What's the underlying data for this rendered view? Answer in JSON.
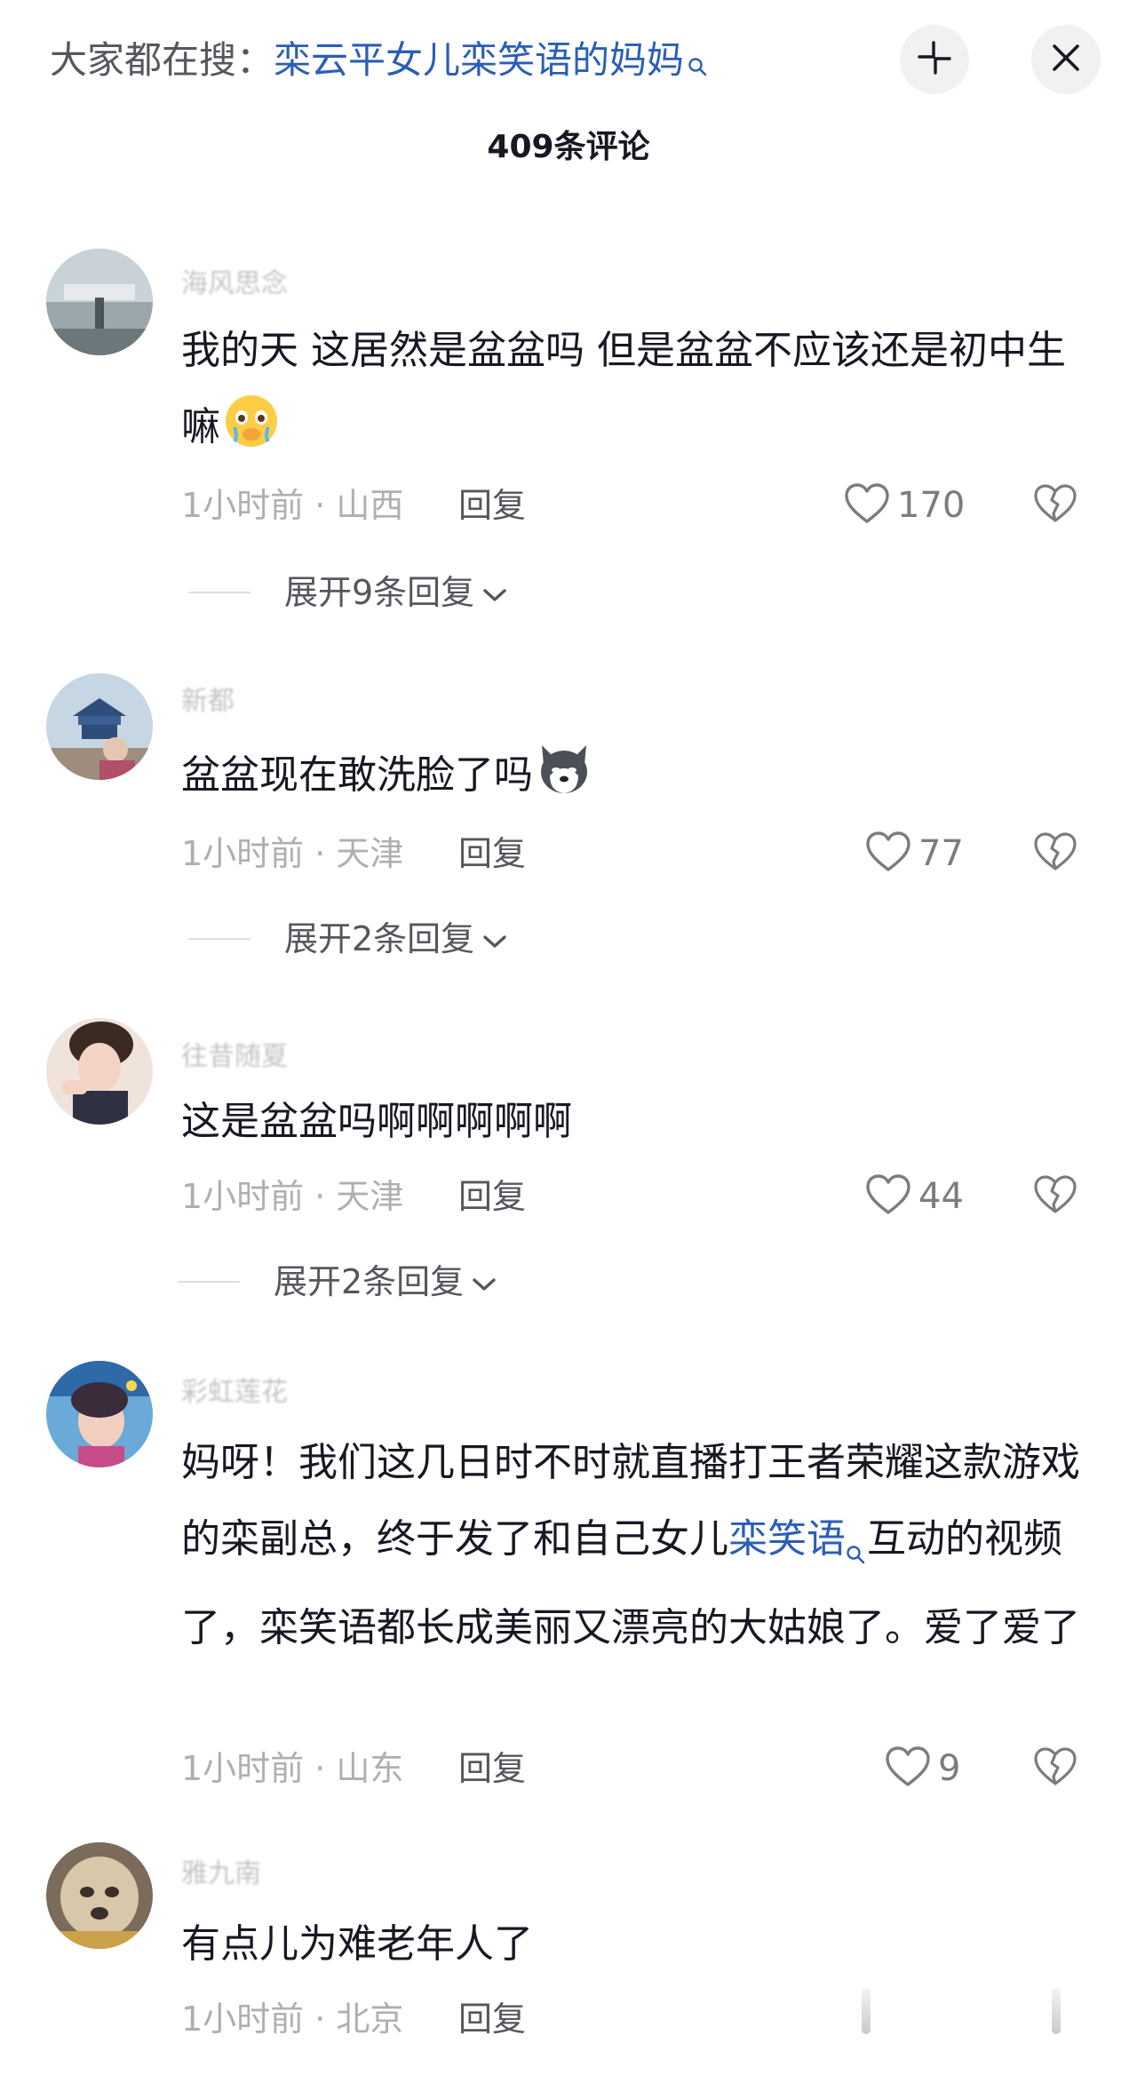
{
  "header": {
    "search_prefix": "大家都在搜：",
    "search_term": "栾云平女儿栾笑语的妈妈",
    "comment_count": "409条评论"
  },
  "comments": [
    {
      "username": "海风思念",
      "text_before_emoji": "我的天 这居然是盆盆吗 但是盆盆不应该还是初中生嘛",
      "emoji": "teary-face-emoji",
      "time_location": "1小时前 · 山西",
      "reply_label": "回复",
      "like_count": "170",
      "expand_label": "展开9条回复"
    },
    {
      "username": "新都",
      "text_before_emoji": "盆盆现在敢洗脸了吗",
      "emoji": "husky-face-emoji",
      "time_location": "1小时前 · 天津",
      "reply_label": "回复",
      "like_count": "77",
      "expand_label": "展开2条回复"
    },
    {
      "username": "往昔随夏",
      "text": "这是盆盆吗啊啊啊啊啊",
      "time_location": "1小时前 · 天津",
      "reply_label": "回复",
      "like_count": "44",
      "expand_label": "展开2条回复"
    },
    {
      "username": "彩虹莲花",
      "text_part1": "妈呀！我们这几日时不时就直播打王者荣耀这款游戏的栾副总，终于发了和自己女儿",
      "text_keyword": "栾笑语",
      "text_part2": "互动的视频了，栾笑语都长成美丽又漂亮的大姑娘了。爱了爱了",
      "time_location": "1小时前 · 山东",
      "reply_label": "回复",
      "like_count": "9"
    },
    {
      "username": "雅九南",
      "text": "有点儿为难老年人了",
      "time_location": "1小时前 · 北京",
      "reply_label": "回复"
    }
  ],
  "colors": {
    "link_blue": "#2a5eb8",
    "text_primary": "#161823",
    "text_secondary": "#aeafb3",
    "icon_gray": "#7b7c80"
  }
}
